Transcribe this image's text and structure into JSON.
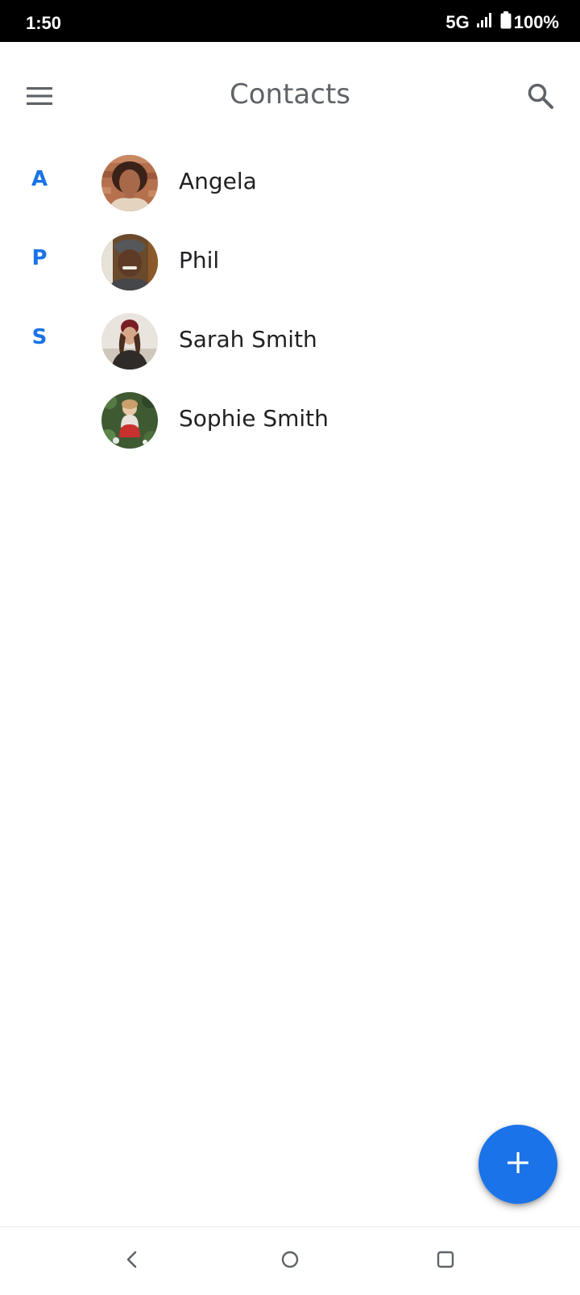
{
  "status_bar": {
    "time": "1:50",
    "network": "5G",
    "battery": "100%"
  },
  "app_bar": {
    "title": "Contacts",
    "menu_icon": "hamburger-menu-icon",
    "search_icon": "search-icon"
  },
  "contacts": [
    {
      "section": "A",
      "name": "Angela"
    },
    {
      "section": "P",
      "name": "Phil"
    },
    {
      "section": "S",
      "name": "Sarah Smith"
    },
    {
      "section": "",
      "name": "Sophie Smith"
    }
  ],
  "fab": {
    "icon": "plus-icon"
  },
  "nav": {
    "back_icon": "back-chevron-icon",
    "home_icon": "home-circle-icon",
    "recents_icon": "recents-square-icon"
  },
  "colors": {
    "accent": "#1a73e8",
    "title": "#5f6368",
    "status_bar_bg": "#000000"
  }
}
